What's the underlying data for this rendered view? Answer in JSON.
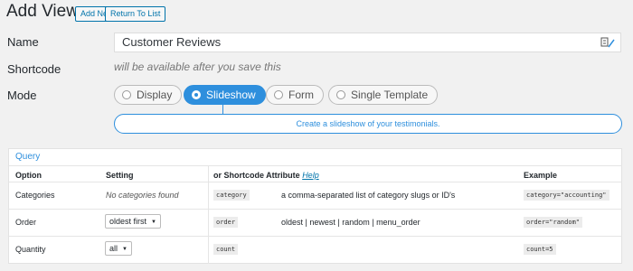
{
  "header": {
    "title": "Add View",
    "add_new_label": "Add New",
    "return_label": "Return To List"
  },
  "form": {
    "name_label": "Name",
    "name_value": "Customer Reviews",
    "shortcode_label": "Shortcode",
    "shortcode_note": "will be available after you save this",
    "mode_label": "Mode",
    "modes": [
      {
        "label": "Display",
        "selected": false
      },
      {
        "label": "Slideshow",
        "selected": true
      },
      {
        "label": "Form",
        "selected": false
      },
      {
        "label": "Single Template",
        "selected": false
      }
    ],
    "mode_description": "Create a slideshow of your testimonials."
  },
  "query": {
    "title": "Query",
    "headers": {
      "option": "Option",
      "setting": "Setting",
      "attribute": "or Shortcode Attribute",
      "help": "Help",
      "example": "Example"
    },
    "rows": [
      {
        "option": "Categories",
        "setting": "No categories found",
        "attribute": "category",
        "description": "a comma-separated list of category slugs or ID's",
        "example": "category=\"accounting\""
      },
      {
        "option": "Order",
        "setting": "oldest first",
        "attribute": "order",
        "description": "oldest | newest | random | menu_order",
        "example": "order=\"random\""
      },
      {
        "option": "Quantity",
        "setting": "all",
        "attribute": "count",
        "description": "",
        "example": "count=5"
      }
    ]
  },
  "colors": {
    "accent": "#2e8fdd",
    "link": "#0073aa",
    "background": "#f1f1f1"
  },
  "icons": {
    "name_field_icon": "key-edit-icon",
    "dropdown_icon": "caret-down-icon"
  }
}
